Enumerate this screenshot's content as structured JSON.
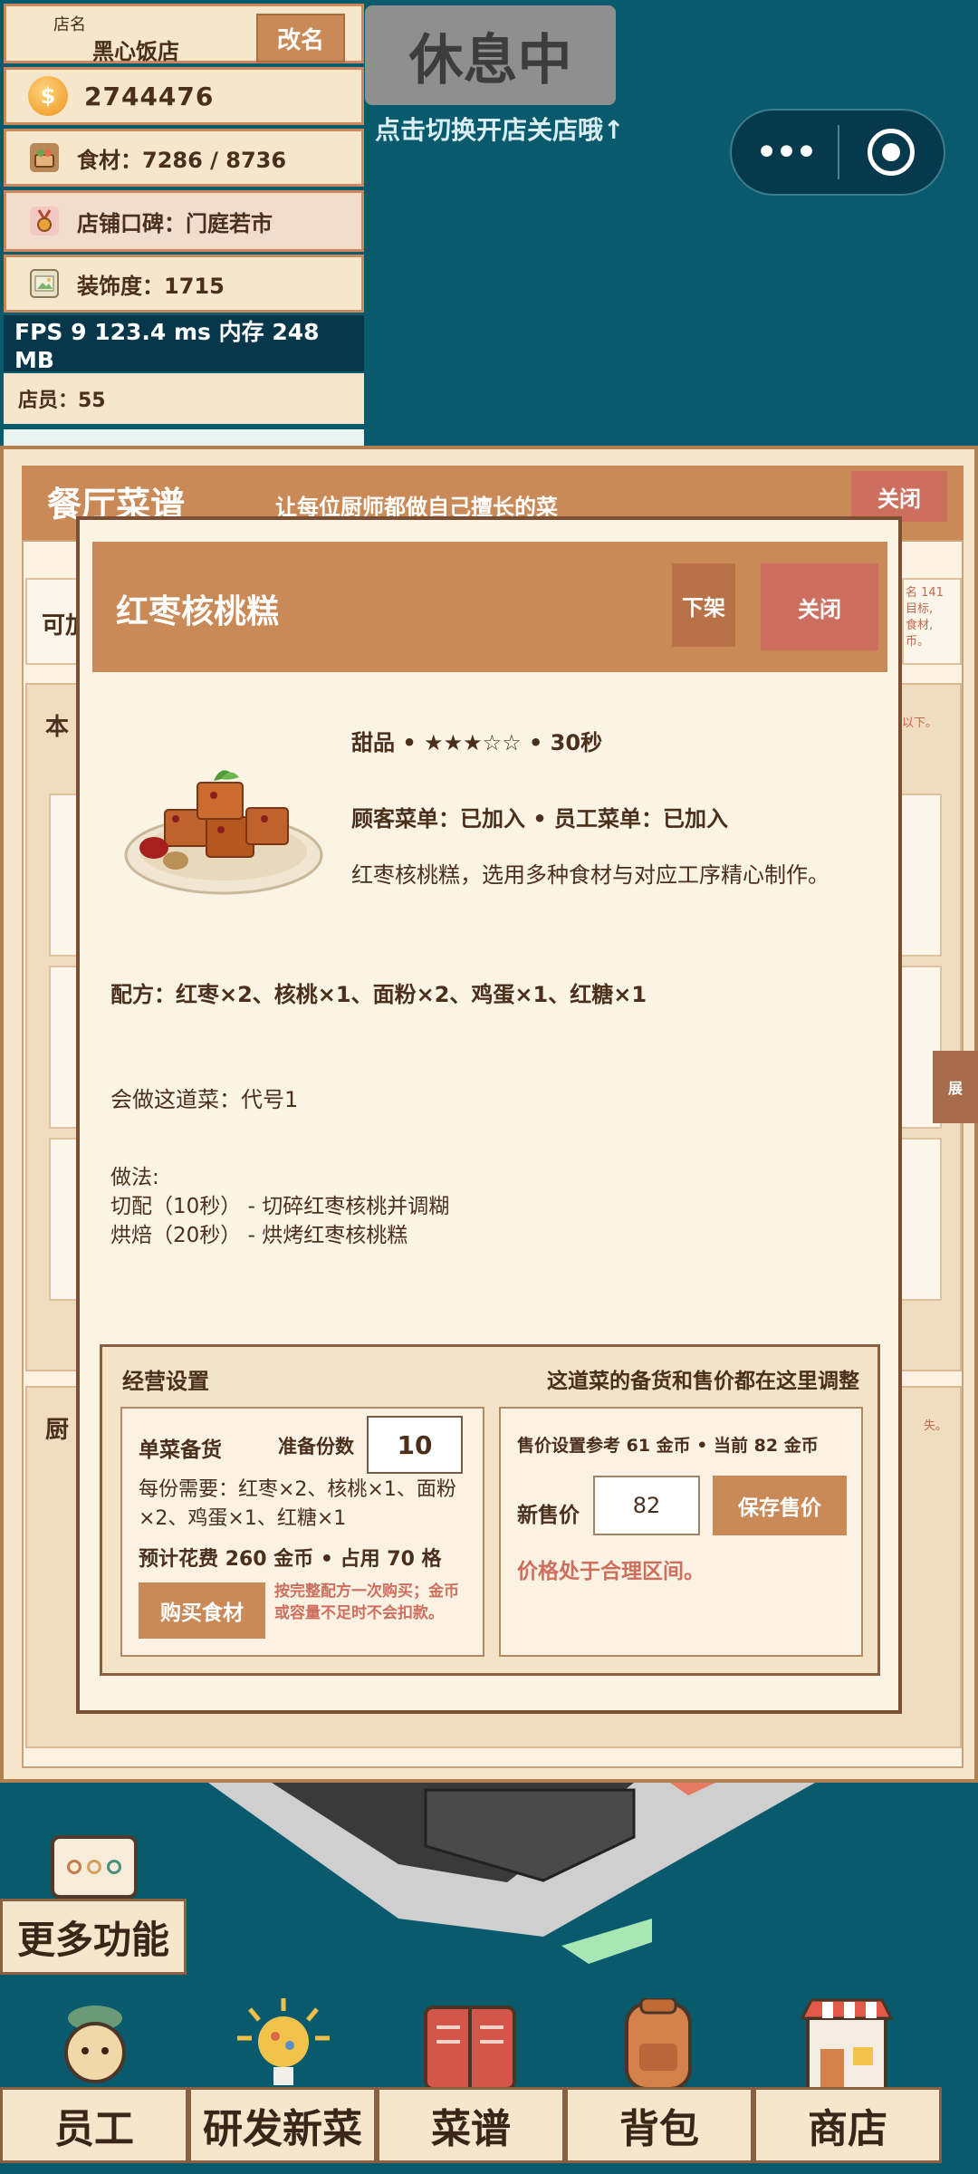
{
  "store": {
    "name_label": "店名",
    "name": "黑心饭店",
    "rename_label": "改名",
    "coins": "2744476",
    "food": "食材：7286 / 8736",
    "reputation": "店铺口碑：门庭若市",
    "decoration": "装饰度：1715",
    "fps": "FPS 9   123.4 ms   内存 248 MB",
    "staff": "店员：55"
  },
  "status": {
    "rest_label": "休息中",
    "hint": "点击切换开店关店哦↑"
  },
  "recipe_dialog": {
    "title": "餐厅菜谱",
    "subtitle": "让每位厨师都做自己擅长的菜",
    "close_label": "关闭",
    "frag_label_1": "可加",
    "frag_label_2": "本",
    "frag_label_3": "厨",
    "frag_note_1": "名 141\n目标,\n食材,\n币。",
    "frag_note_2": "以下。",
    "frag_note_3": "失。",
    "expand_label": "展"
  },
  "dish": {
    "title": "红枣核桃糕",
    "unlist_label": "下架",
    "close_label": "关闭",
    "meta": "甜品 • ★★★☆☆ • 30秒",
    "menus": "顾客菜单：已加入   •   员工菜单：已加入",
    "description": "红枣核桃糕，选用多种食材与对应工序精心制作。",
    "recipe": "配方：红枣×2、核桃×1、面粉×2、鸡蛋×1、红糖×1",
    "cooks": "会做这道菜：代号1",
    "method_title": "做法:",
    "method_steps": [
      "切配（10秒） - 切碎红枣核桃并调糊",
      "烘焙（20秒） - 烘烤红枣核桃糕"
    ]
  },
  "business": {
    "title": "经营设置",
    "hint": "这道菜的备货和售价都在这里调整",
    "stock_title": "单菜备货",
    "qty_label": "准备份数",
    "qty_value": "10",
    "need": "每份需要：红枣×2、核桃×1、面粉×2、鸡蛋×1、红糖×1",
    "cost": "预计花费 260 金币 • 占用 70 格",
    "buy_label": "购买食材",
    "buy_note": "按完整配方一次购买；金币或容量不足时不会扣款。",
    "price_ref": "售价设置参考 61 金币 • 当前 82 金币",
    "new_price_label": "新售价",
    "new_price_value": "82",
    "save_label": "保存售价",
    "price_status": "价格处于合理区间。"
  },
  "bottom": {
    "more_label": "更多功能",
    "nav": [
      "员工",
      "研发新菜",
      "菜谱",
      "背包",
      "商店"
    ]
  },
  "colors": {
    "background": "#0a5a6e",
    "accent": "#c98a58",
    "danger": "#cd6f5e",
    "panel": "#f6e6cc"
  }
}
